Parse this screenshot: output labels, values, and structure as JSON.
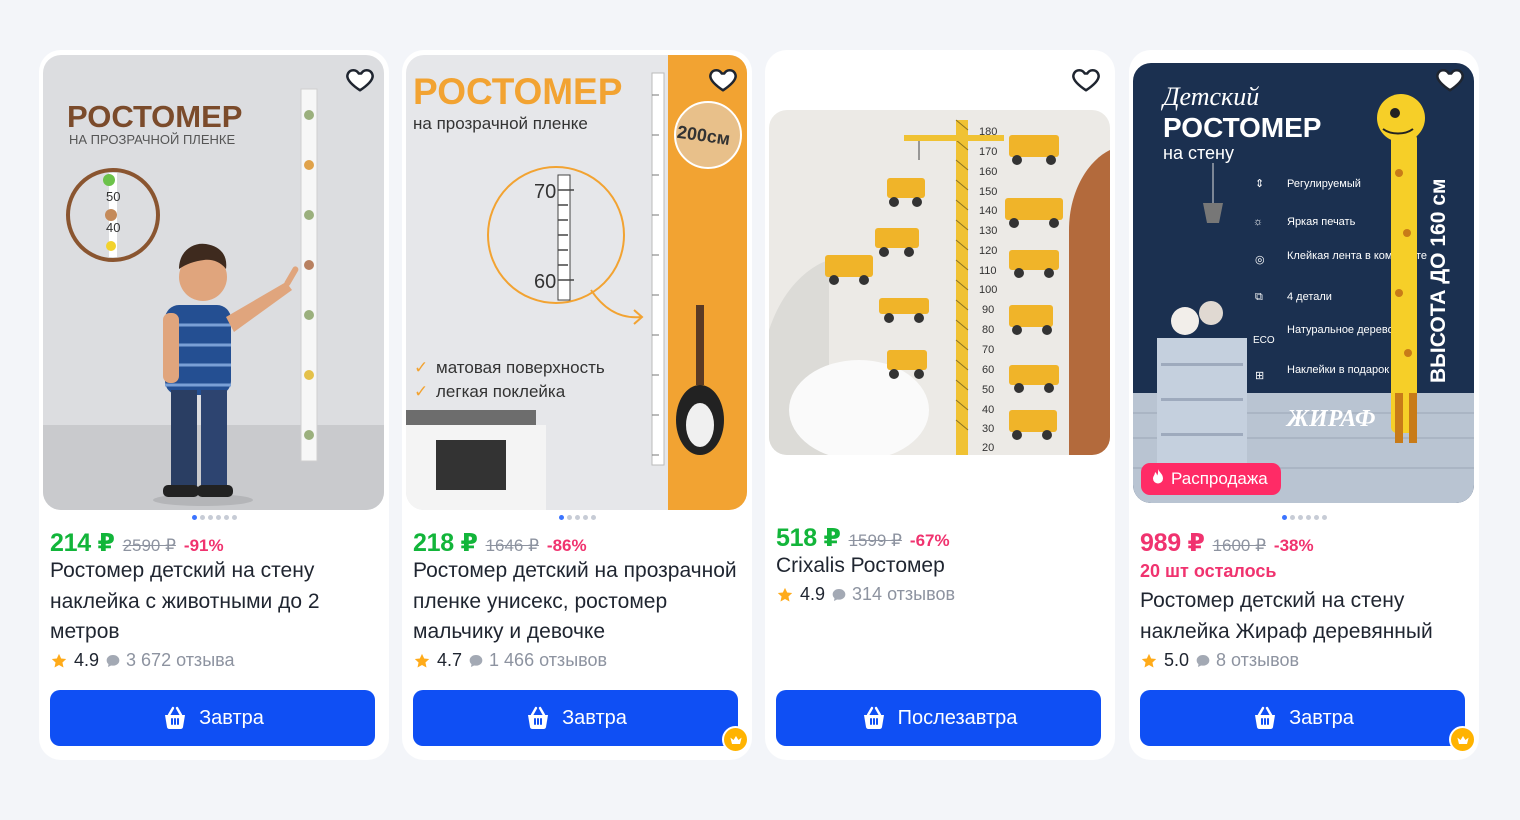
{
  "colors": {
    "accent": "#0f4ff4",
    "price_green": "#12b53a",
    "price_pink": "#f0336f",
    "star": "#ffab1a"
  },
  "cards": [
    {
      "price": "214 ₽",
      "old_price": "2590 ₽",
      "discount": "-91%",
      "title": "Ростомер детский на стену наклейка с животными до 2 метров",
      "rating": "4.9",
      "reviews": "3 672 отзыва",
      "button": "Завтра",
      "image_text": {
        "heading": "РОСТОМЕР",
        "subheading": "НА ПРОЗРАЧНОЙ ПЛЕНКЕ",
        "mark_50": "50",
        "mark_40": "40"
      }
    },
    {
      "price": "218 ₽",
      "old_price": "1646 ₽",
      "discount": "-86%",
      "title": "Ростомер детский на прозрачной пленке унисекс, ростомер мальчику и девочке",
      "rating": "4.7",
      "reviews": "1 466 отзывов",
      "button": "Завтра",
      "image_text": {
        "heading": "РОСТОМЕР",
        "subheading": "на прозрачной пленке",
        "badge": "200см",
        "mark_70": "70",
        "mark_60": "60",
        "feature_1": "матовая поверхность",
        "feature_2": "легкая поклейка"
      }
    },
    {
      "price": "518 ₽",
      "old_price": "1599 ₽",
      "discount": "-67%",
      "title": "Crixalis Ростомер",
      "rating": "4.9",
      "reviews": "314 отзывов",
      "button": "Послезавтра",
      "image_text": {
        "scale": [
          "180",
          "170",
          "160",
          "150",
          "140",
          "130",
          "120",
          "110",
          "100",
          "90",
          "80",
          "70",
          "60",
          "50",
          "40",
          "30",
          "20"
        ]
      }
    },
    {
      "price": "989 ₽",
      "old_price": "1600 ₽",
      "discount": "-38%",
      "stock": "20 шт осталось",
      "title": "Ростомер детский на стену наклейка Жираф деревянный",
      "rating": "5.0",
      "reviews": "8 отзывов",
      "button": "Завтра",
      "badge": "Распродажа",
      "image_text": {
        "heading_1": "Детский",
        "heading_2": "РОСТОМЕР",
        "heading_3": "на стену",
        "feature_1": "Регулируемый",
        "feature_2": "Яркая печать",
        "feature_3": "Клейкая лента в комплекте",
        "feature_4": "4 детали",
        "feature_5": "Натуральное дерево",
        "feature_6": "Наклейки в подарок",
        "eco": "ECO",
        "brand": "ЖИРАФ",
        "vertical": "ВЫСОТА ДО 160 см"
      }
    }
  ]
}
